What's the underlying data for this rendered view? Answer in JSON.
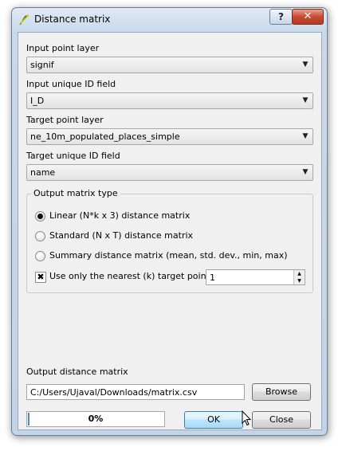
{
  "window": {
    "title": "Distance matrix",
    "icon": "qgis-icon",
    "help_label": "?",
    "close_label": "✕"
  },
  "form": {
    "input_point_layer": {
      "label": "Input point layer",
      "value": "signif"
    },
    "input_unique_id": {
      "label": "Input unique ID field",
      "value": "I_D"
    },
    "target_point_layer": {
      "label": "Target point layer",
      "value": "ne_10m_populated_places_simple"
    },
    "target_unique_id": {
      "label": "Target unique ID field",
      "value": "name"
    }
  },
  "matrix_type": {
    "title": "Output matrix type",
    "selected": "linear",
    "options": [
      {
        "id": "linear",
        "label": "Linear (N*k x 3) distance matrix"
      },
      {
        "id": "standard",
        "label": "Standard (N x T) distance matrix"
      },
      {
        "id": "summary",
        "label": "Summary distance matrix (mean, std. dev., min, max)"
      }
    ],
    "nearest": {
      "label": "Use only the nearest (k) target points",
      "checked": true,
      "check_glyph": "✖",
      "value": "1",
      "up_glyph": "▲",
      "down_glyph": "▼"
    }
  },
  "output": {
    "label": "Output distance matrix",
    "path": "C:/Users/Ujaval/Downloads/matrix.csv",
    "browse_label": "Browse"
  },
  "progress": {
    "value": 0,
    "text": "0%"
  },
  "buttons": {
    "ok_label": "OK",
    "close_label": "Close"
  },
  "dropdown_glyph": "▼"
}
